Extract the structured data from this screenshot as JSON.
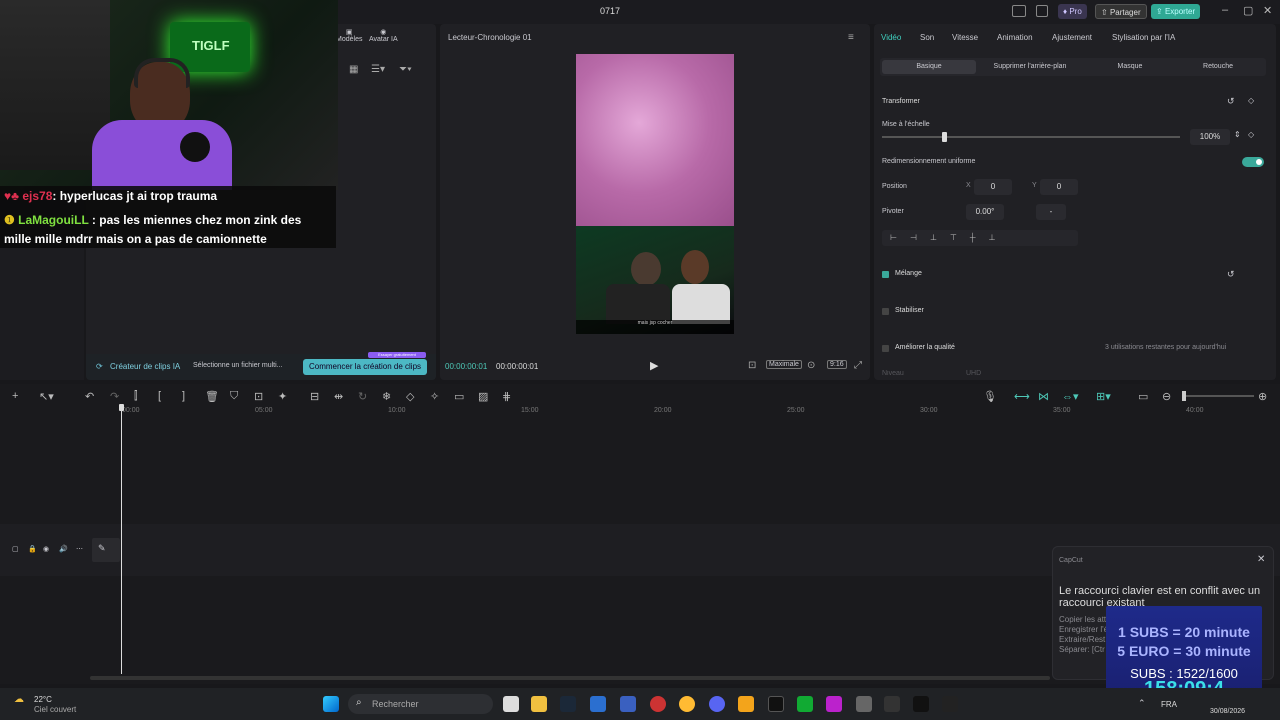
{
  "app": {
    "title": "0717",
    "pro_label": "Pro",
    "share_label": "Partager",
    "export_label": "Exporter"
  },
  "left_panel": {
    "tabs": [
      "Modèles",
      "Avatar IA"
    ],
    "clip_creator": "Créateur de clips IA",
    "file_select": "Sélectionne un fichier multi...",
    "start_btn": "Commencer la création de clips",
    "badge": "Essayer gratuitement"
  },
  "preview": {
    "title": "Lecteur-Chronologie 01",
    "time_current": "00:00:00:01",
    "time_total": "00:00:00:01",
    "quality": "Maximale",
    "ratio": "9:16"
  },
  "props": {
    "tabs": [
      "Vidéo",
      "Son",
      "Vitesse",
      "Animation",
      "Ajustement",
      "Stylisation par l'IA"
    ],
    "subtabs": [
      "Basique",
      "Supprimer l'arrière-plan",
      "Masque",
      "Retouche"
    ],
    "transform": "Transformer",
    "scale_label": "Mise à l'échelle",
    "scale_value": "100%",
    "scale_level": 0.2,
    "uniform": "Redimensionnement uniforme",
    "position": "Position",
    "x_label": "X",
    "x_value": "0",
    "y_label": "Y",
    "y_value": "0",
    "rotate": "Pivoter",
    "rotate_value": "0.00°",
    "rotate_dash": "-",
    "blend": "Mélange",
    "stabilize": "Stabiliser",
    "quality": "Améliorer la qualité",
    "quality_note": "3 utilisations restantes pour aujourd'hui",
    "level_label": "Niveau",
    "level_value": "UHD"
  },
  "ruler": [
    "00:00",
    "05:00",
    "10:00",
    "15:00",
    "20:00",
    "25:00",
    "30:00",
    "35:00",
    "40:00"
  ],
  "notification": {
    "app": "CapCut",
    "title": "Le raccourci clavier est en conflit avec un raccourci existant",
    "lines": [
      "Copier les att",
      "Enregistrer l'é",
      "Extraire/Rest",
      "Séparer: [Ctr"
    ]
  },
  "subs": {
    "line1": "1 SUBS = 20 minute",
    "line2": "5 EURO = 30 minute",
    "count": "SUBS : 1522/1600",
    "timer": "158:09:4"
  },
  "chat": {
    "msg1_user": "ejs78",
    "msg1_text": ": hyperlucas jt ai trop trauma",
    "msg2_user": "LaMagouiLL",
    "msg2_text": ": pas les miennes chez mon zink des mille mille mdrr mais on a pas de camionnette"
  },
  "webcam": {
    "neon": "TIGLF"
  },
  "video": {
    "caption": "mais jsp cocher"
  },
  "taskbar": {
    "weather_temp": "22°C",
    "weather_desc": "Ciel couvert",
    "search": "Rechercher",
    "lang": "FRA",
    "date": "30/08/2026"
  },
  "colors": {
    "accent": "#4ec9b8",
    "tab_active": "#3fd0c0",
    "subs_text": "#ffffff",
    "timer": "#3be0e8"
  }
}
